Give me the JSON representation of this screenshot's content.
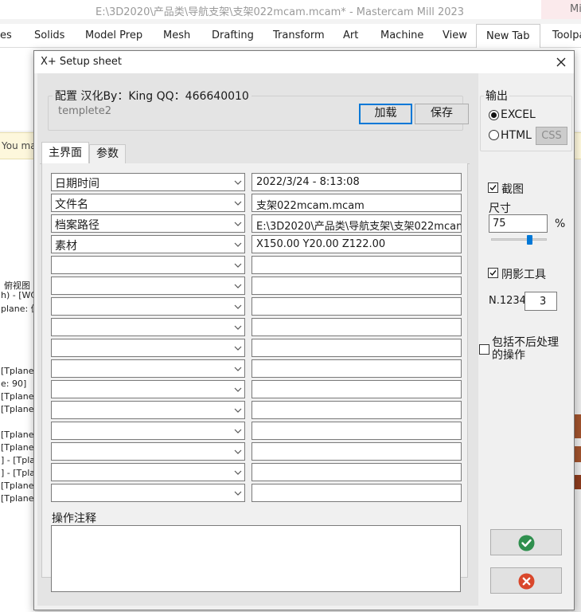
{
  "app": {
    "title": "E:\\3D2020\\产品类\\导航支架\\支架022mcam.mcam* - Mastercam Mill 2023",
    "corner_text": "Mi"
  },
  "ribbon": {
    "tabs": [
      "es",
      "Solids",
      "Model Prep",
      "Mesh",
      "Drafting",
      "Transform",
      "Art",
      "Machine",
      "View",
      "New Tab",
      "Toolpa"
    ],
    "active_tab": "New Tab"
  },
  "background": {
    "yellow_bar_text": "You ma",
    "left_lines": [
      "俯视图",
      "h) - [WC",
      "plane: 俯",
      "[Tplane:",
      "e: 90]",
      "[Tplane:",
      "[Tplane:",
      "[Tplane:",
      "[Tplane:",
      "] - [Tplar",
      "] - [Tplar",
      "[Tplane:",
      "[Tplane:"
    ]
  },
  "dialog": {
    "title": "X+ Setup sheet",
    "config_group": {
      "label": "配置   汉化By：King  QQ：466640010",
      "template": "templete2",
      "load_label": "加载",
      "save_label": "保存"
    },
    "tabs": {
      "main": "主界面",
      "params": "参数"
    },
    "rows": [
      {
        "field": "日期时间",
        "value": "2022/3/24 - 8:13:08"
      },
      {
        "field": "文件名",
        "value": "支架022mcam.mcam"
      },
      {
        "field": "档案路径",
        "value": "E:\\3D2020\\产品类\\导航支架\\支架022mcam.mcam"
      },
      {
        "field": "素材",
        "value": "X150.00 Y20.00 Z122.00"
      },
      {
        "field": "",
        "value": ""
      },
      {
        "field": "",
        "value": ""
      },
      {
        "field": "",
        "value": ""
      },
      {
        "field": "",
        "value": ""
      },
      {
        "field": "",
        "value": ""
      },
      {
        "field": "",
        "value": ""
      },
      {
        "field": "",
        "value": ""
      },
      {
        "field": "",
        "value": ""
      },
      {
        "field": "",
        "value": ""
      },
      {
        "field": "",
        "value": ""
      },
      {
        "field": "",
        "value": ""
      },
      {
        "field": "",
        "value": ""
      }
    ],
    "notes_label": "操作注释",
    "output": {
      "label": "输出",
      "excel": "EXCEL",
      "html": "HTML",
      "css": "CSS",
      "selected": "EXCEL"
    },
    "screenshot": {
      "label": "截图",
      "checked": true,
      "size_label": "尺寸",
      "size_value": "75",
      "size_unit": "%",
      "slider_fraction": 0.66
    },
    "shadow_tools": {
      "label": "阴影工具",
      "checked": true
    },
    "number": {
      "label": "N.1234",
      "value": "3"
    },
    "include_unprocessed": {
      "label_line1": "包括不后处理",
      "label_line2": "的操作",
      "checked": false
    },
    "colors": {
      "ok_icon": "#2f8f4e",
      "cancel_icon": "#d9472b",
      "accent": "#0078d7"
    }
  }
}
